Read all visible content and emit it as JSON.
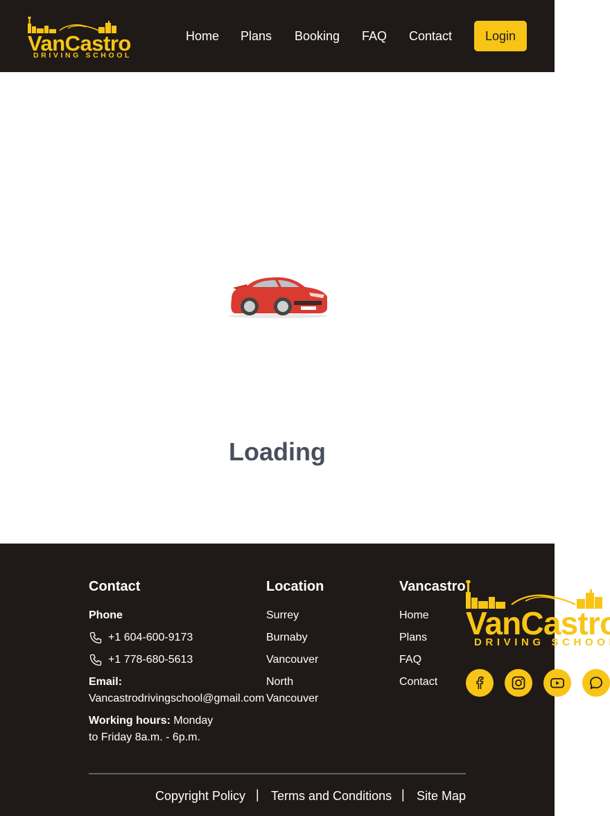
{
  "brand": {
    "name": "VanCastro",
    "tagline": "DRIVING SCHOOL",
    "color": "#f8c516"
  },
  "nav": {
    "items": [
      "Home",
      "Plans",
      "Booking",
      "FAQ",
      "Contact"
    ],
    "login_label": "Login"
  },
  "main": {
    "loading_text": "Loading",
    "loading_icon": "car-icon"
  },
  "footer": {
    "contact": {
      "title": "Contact",
      "phone_label": "Phone",
      "phones": [
        "+1 604-600-9173",
        "+1 778-680-5613"
      ],
      "email_label": "Email:",
      "email": "Vancastrodrivingschool@gmail.com",
      "hours_label": "Working hours:",
      "hours_line1": "Monday",
      "hours_line2": "to Friday 8a.m. - 6p.m."
    },
    "location": {
      "title": "Location",
      "items": [
        "Surrey",
        "Burnaby",
        "Vancouver",
        "North",
        "Vancouver"
      ]
    },
    "vancastro": {
      "title": "Vancastro",
      "links": [
        "Home",
        "Plans",
        "FAQ",
        "Contact"
      ]
    },
    "social_icons": [
      "facebook-icon",
      "instagram-icon",
      "youtube-icon",
      "chat-icon"
    ],
    "bottom_links": [
      "Copyright Policy",
      "Terms and Conditions",
      "Site Map"
    ],
    "separator": "|"
  },
  "colors": {
    "dark": "#1f1a17",
    "accent": "#f8c516",
    "loading_text": "#48505e",
    "divider": "#5d646c"
  }
}
